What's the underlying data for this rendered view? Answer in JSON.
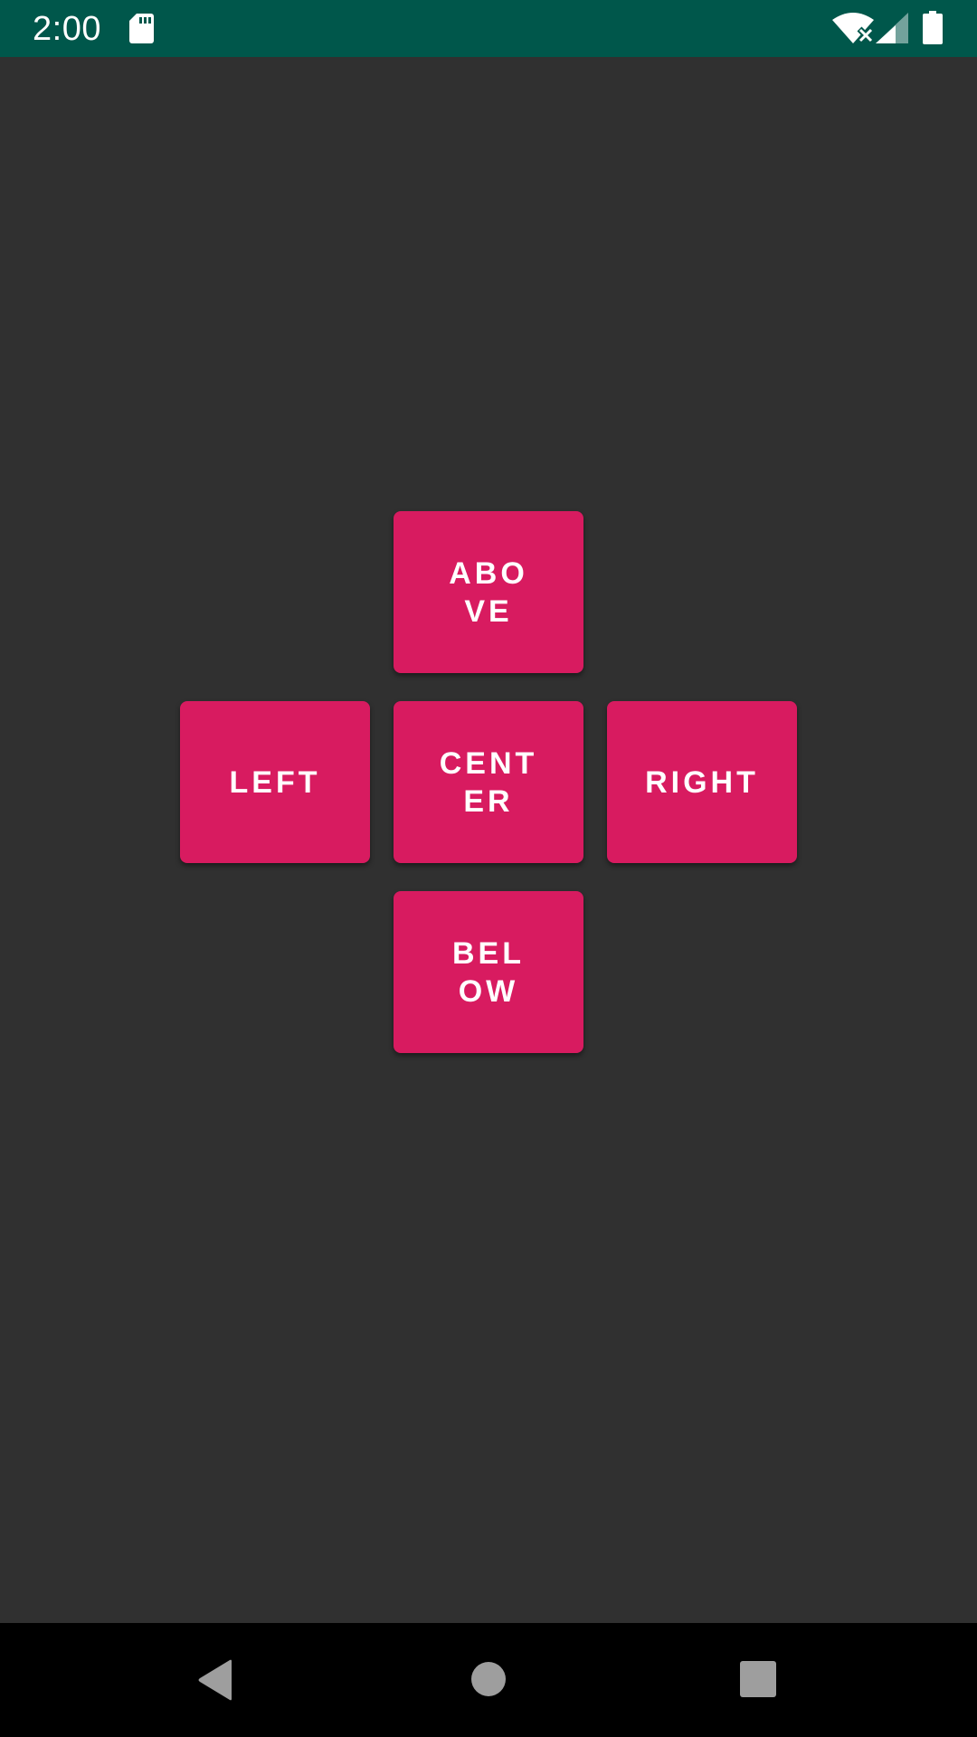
{
  "status_bar": {
    "time": "2:00",
    "icons": [
      "sd-card-icon",
      "wifi-off-icon",
      "cell-signal-icon",
      "battery-icon"
    ],
    "background_color": "#00574b"
  },
  "buttons": {
    "above": "ABOVE",
    "left": "LEFT",
    "center": "CENTER",
    "right": "RIGHT",
    "below": "BELOW",
    "color": "#d81b60"
  },
  "nav_bar": {
    "icons": [
      "back-icon",
      "home-icon",
      "recents-icon"
    ]
  },
  "colors": {
    "background": "#303030",
    "nav_background": "#000000"
  }
}
